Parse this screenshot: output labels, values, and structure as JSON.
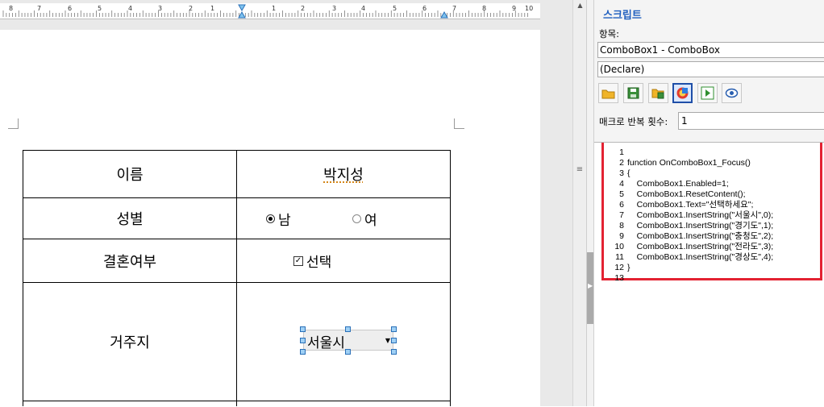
{
  "document": {
    "ruler_numbers": [
      "8",
      "7",
      "6",
      "5",
      "4",
      "3",
      "2",
      "1",
      "1",
      "2",
      "3",
      "4",
      "5",
      "6",
      "7",
      "8",
      "9",
      "10"
    ],
    "table": {
      "rows": [
        {
          "label": "이름",
          "value": "박지성"
        },
        {
          "label": "성별",
          "radio_options": [
            {
              "label": "남",
              "checked": true
            },
            {
              "label": "여",
              "checked": false
            }
          ]
        },
        {
          "label": "결혼여부",
          "checkbox": {
            "label": "선택",
            "checked": true
          }
        },
        {
          "label": "거주지",
          "combo_value": "서울시"
        }
      ]
    }
  },
  "panel": {
    "title": "스크립트",
    "item_label": "항목:",
    "object_field": "ComboBox1 - ComboBox",
    "procedure_field": "(Declare)",
    "toolbar_icons": [
      "folder-open-icon",
      "save-icon",
      "folder-save-icon",
      "script-window-icon",
      "run-icon",
      "view-icon"
    ],
    "repeat_label": "매크로 반복 횟수:",
    "repeat_value": "1",
    "code_lines": [
      {
        "no": "1",
        "text": ""
      },
      {
        "no": "2",
        "text": "function OnComboBox1_Focus()"
      },
      {
        "no": "3",
        "text": "{"
      },
      {
        "no": "4",
        "text": "    ComboBox1.Enabled=1;"
      },
      {
        "no": "5",
        "text": "    ComboBox1.ResetContent();"
      },
      {
        "no": "6",
        "text": "    ComboBox1.Text=\"선택하세요\";"
      },
      {
        "no": "7",
        "text": "    ComboBox1.InsertString(\"서울시\",0);"
      },
      {
        "no": "8",
        "text": "    ComboBox1.InsertString(\"경기도\",1);"
      },
      {
        "no": "9",
        "text": "    ComboBox1.InsertString(\"충청도\",2);"
      },
      {
        "no": "10",
        "text": "    ComboBox1.InsertString(\"전라도\",3);"
      },
      {
        "no": "11",
        "text": "    ComboBox1.InsertString(\"경상도\",4);"
      },
      {
        "no": "12",
        "text": "}"
      },
      {
        "no": "13",
        "text": ""
      }
    ]
  },
  "colors": {
    "highlight": "#e32232",
    "panel_title": "#1f5fbf",
    "selection_handle": "#9fd0f5"
  }
}
